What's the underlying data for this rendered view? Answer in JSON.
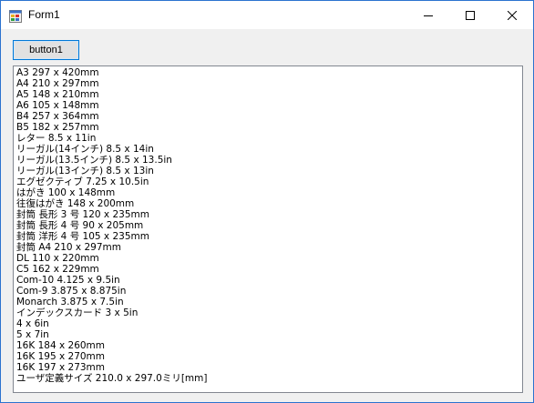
{
  "window": {
    "title": "Form1",
    "controls": {
      "minimize": "minimize-icon",
      "maximize": "maximize-icon",
      "close": "close-icon"
    },
    "accent_color": "#2b73cf"
  },
  "toolbar": {
    "button1_label": "button1"
  },
  "paper_list": {
    "items": [
      "A3 297 x 420mm",
      "A4 210 x 297mm",
      "A5 148 x 210mm",
      "A6 105 x 148mm",
      "B4 257 x 364mm",
      "B5 182 x 257mm",
      "レター 8.5 x 11in",
      "リーガル(14インチ) 8.5 x 14in",
      "リーガル(13.5インチ) 8.5 x 13.5in",
      "リーガル(13インチ) 8.5 x 13in",
      "エグゼクティブ 7.25 x 10.5in",
      "はがき 100 x 148mm",
      "往復はがき 148 x 200mm",
      "封筒 長形 3 号 120 x 235mm",
      "封筒 長形 4 号 90 x 205mm",
      "封筒 洋形 4 号 105 x 235mm",
      "封筒 A4 210 x 297mm",
      "DL 110 x 220mm",
      "C5 162 x 229mm",
      "Com-10 4.125 x 9.5in",
      "Com-9 3.875 x 8.875in",
      "Monarch 3.875 x 7.5in",
      "インデックスカード 3 x 5in",
      "4 x 6in",
      "5 x 7in",
      "16K 184 x 260mm",
      "16K 195 x 270mm",
      "16K 197 x 273mm",
      "ユーザ定義サイズ 210.0 x 297.0ミリ[mm]"
    ]
  }
}
